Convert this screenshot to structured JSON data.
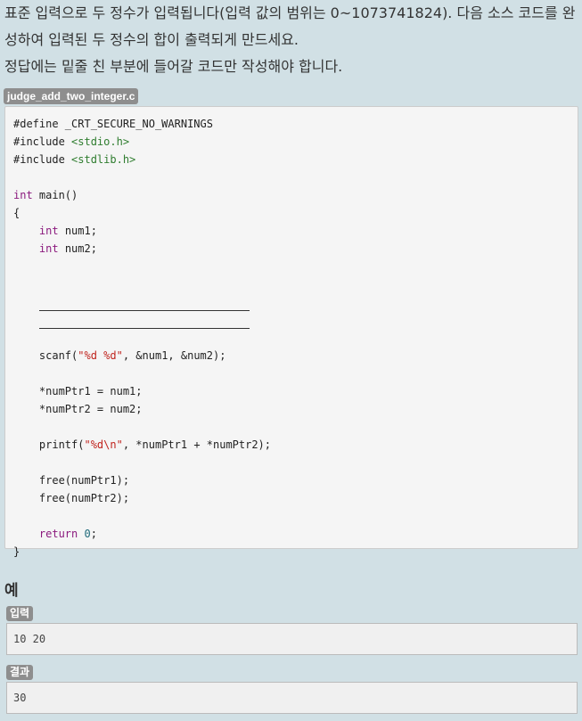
{
  "description": {
    "line1": "표준 입력으로 두 정수가 입력됩니다(입력 값의 범위는 0~1073741824). 다음 소스 코드를 완성하여 입력된 두 정수의 합이 출력되게 만드세요.",
    "line2": "정답에는 밑줄 친 부분에 들어갈 코드만 작성해야 합니다."
  },
  "file_tag": "judge_add_two_integer.c",
  "code": {
    "define": "#define _CRT_SECURE_NO_WARNINGS",
    "include_kw": "#include",
    "inc1": "<stdio.h>",
    "inc2": "<stdlib.h>",
    "int_kw": "int",
    "main_sig": " main()",
    "open_brace": "{",
    "num1_decl": " num1;",
    "num2_decl": " num2;",
    "scanf_fn": "scanf(",
    "scanf_fmt": "\"%d %d\"",
    "scanf_args": ", &num1, &num2);",
    "assign1": "*numPtr1 = num1;",
    "assign2": "*numPtr2 = num2;",
    "printf_fn": "printf(",
    "printf_fmt": "\"%d\\n\"",
    "printf_args": ", *numPtr1 + *numPtr2);",
    "free1": "free(numPtr1);",
    "free2": "free(numPtr2);",
    "return_kw": "return",
    "return_val": "0",
    "semicolon": ";",
    "close_brace": "}"
  },
  "example": {
    "title": "예",
    "input_label": "입력",
    "input_value": "10 20",
    "output_label": "결과",
    "output_value": "30"
  }
}
